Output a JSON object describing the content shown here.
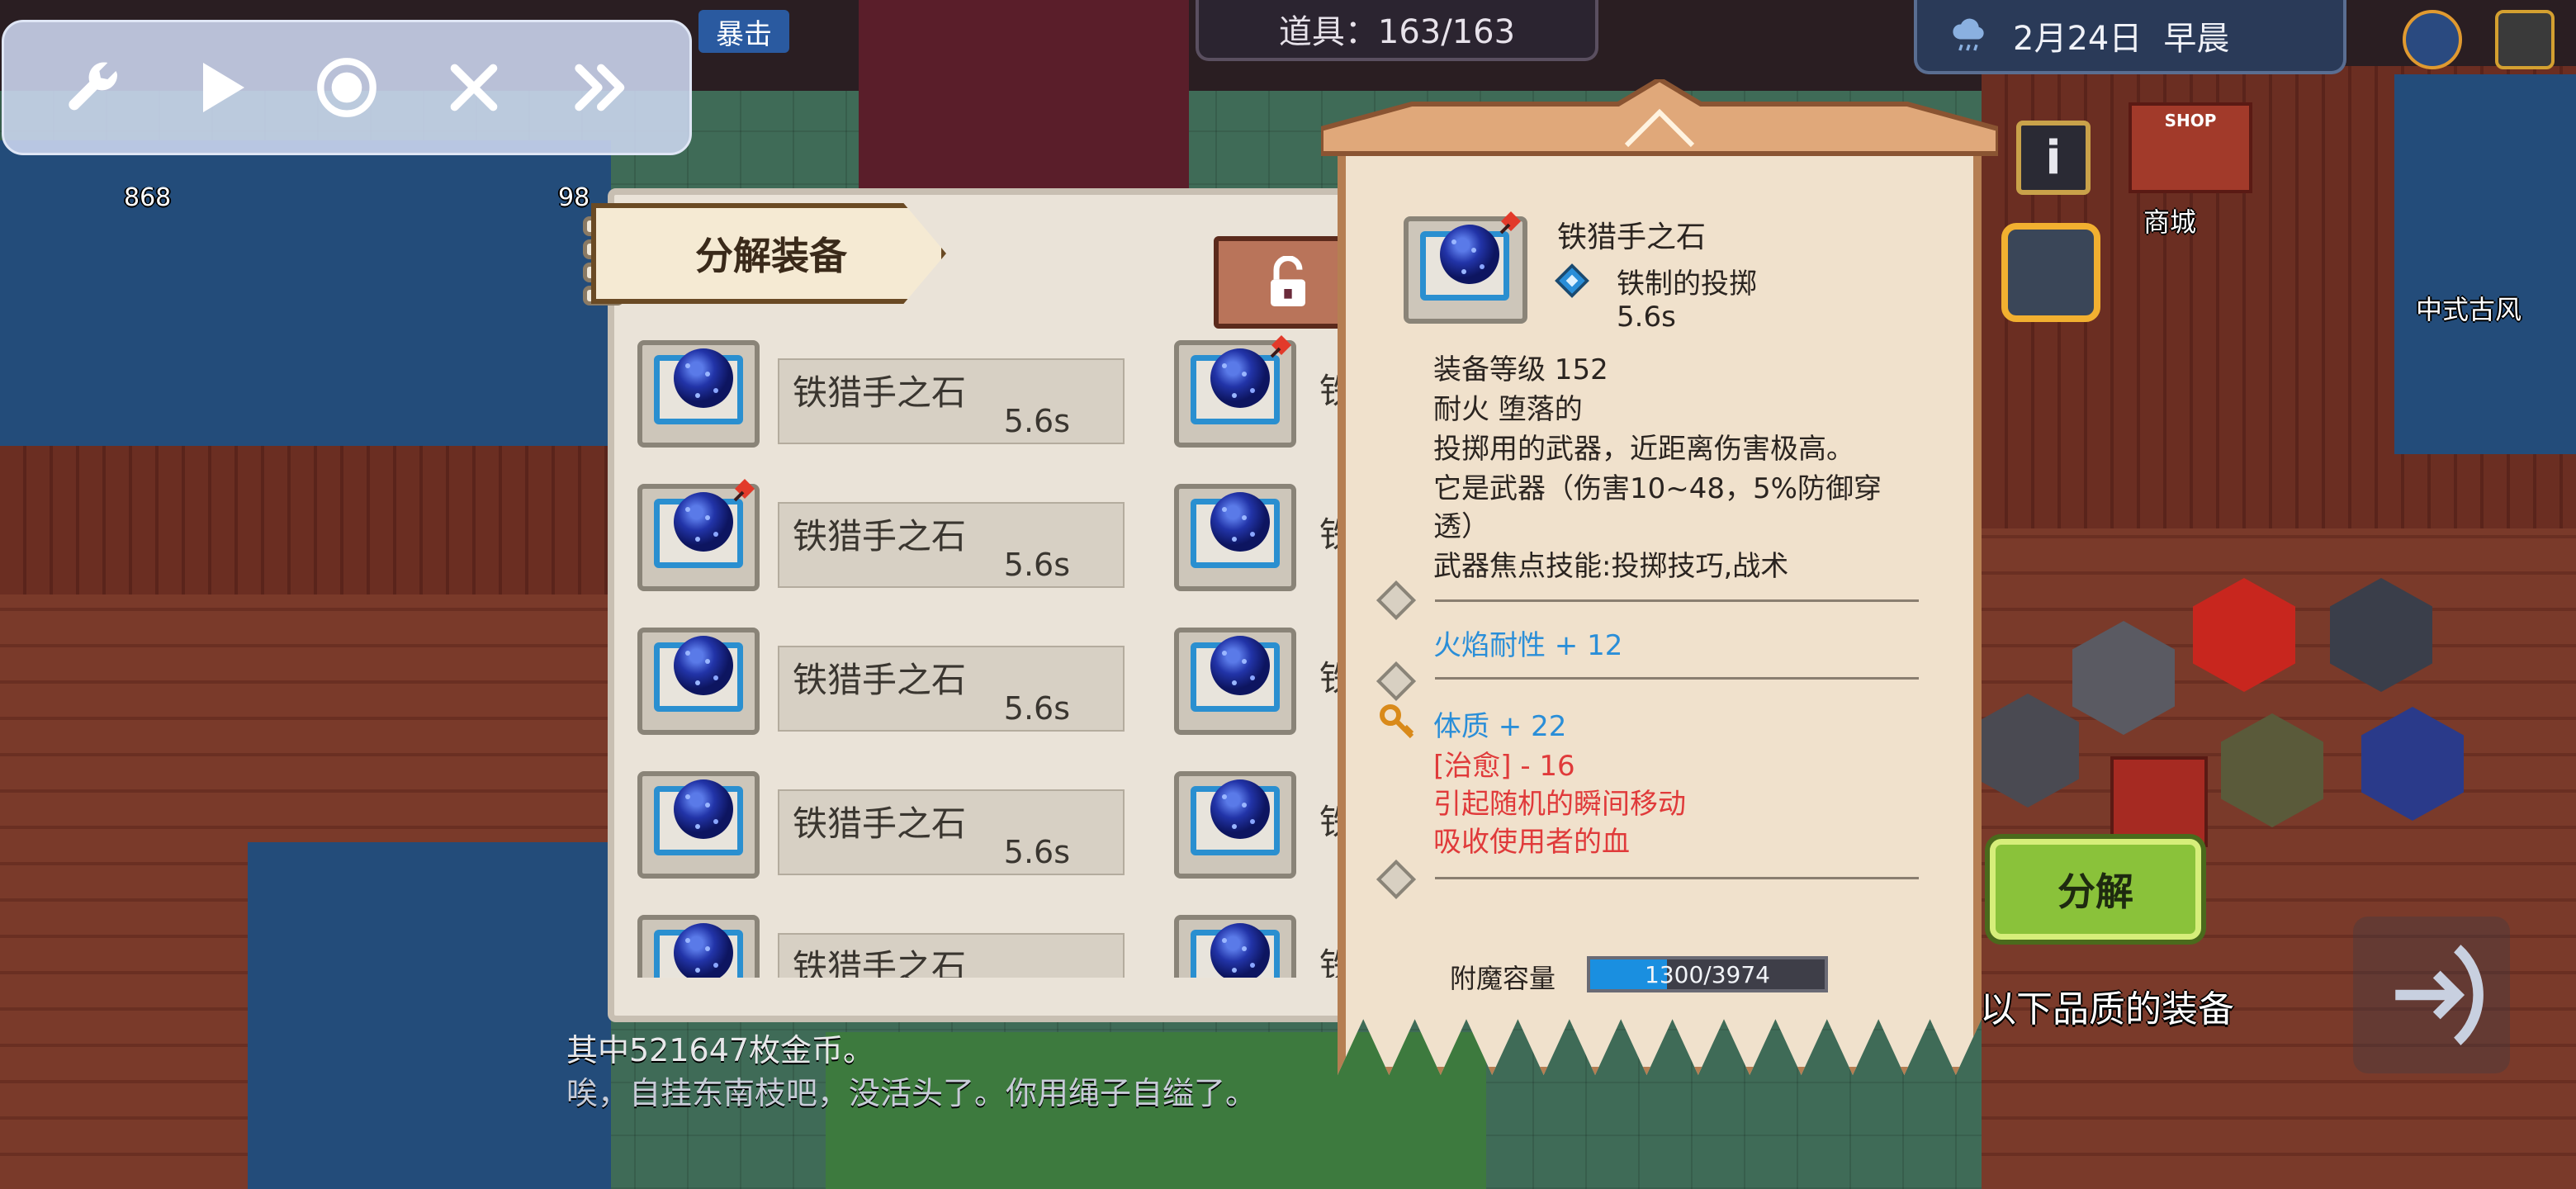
{
  "toolbar": {
    "buttons": [
      "settings",
      "play",
      "record",
      "close",
      "fast-forward"
    ]
  },
  "top_bar": {
    "items_count": "道具：163/163",
    "date": "2月24日",
    "time_of_day": "早晨",
    "attack_tag": "暴击",
    "counter_left": "868",
    "counter_mid": "98"
  },
  "panel": {
    "title": "分解装备",
    "items": [
      {
        "name": "铁猎手之石",
        "time": "5.6s"
      },
      {
        "name": "铁猎手之石",
        "time": "5.6s"
      },
      {
        "name": "铁猎手之石",
        "time": "5.6s"
      },
      {
        "name": "铁猎手之石",
        "time": "5.6s"
      },
      {
        "name": "铁猎手之石",
        "time": ""
      }
    ],
    "col2_label": "铁"
  },
  "tooltip": {
    "name": "铁猎手之石",
    "type": "铁制的投掷",
    "speed": "5.6s",
    "level": "装备等级 152",
    "traits": "耐火 堕落的",
    "desc1": "投掷用的武器，近距离伤害极高。",
    "desc2": "它是武器（伤害10~48，5%防御穿",
    "desc3": "透）",
    "skill": "武器焦点技能:投掷技巧,战术",
    "stat_fire": "火焰耐性 + 12",
    "stat_con": "体质 + 22",
    "stat_heal": "[治愈] - 16",
    "stat_teleport": "引起随机的瞬间移动",
    "stat_drain": "吸收使用者的血",
    "enchant_label": "附魔容量",
    "enchant_value": "1300/3974",
    "enchant_fraction": 0.327
  },
  "hud": {
    "decompose_label": "分解",
    "quality_text": "以下品质的装备",
    "shop_label": "商城",
    "shop_sign": "SHOP",
    "style_label": "中式古风",
    "info_label": "i"
  },
  "chat": {
    "line1": "其中521647枚金币。",
    "line2": "唉，自挂东南枝吧，没活头了。你用绳子自缢了。"
  },
  "colors": {
    "accent_green": "#8ac23a",
    "stat_blue": "#2a8ed8",
    "stat_red": "#e03a3a",
    "enchant_blue": "#1a8fe0"
  }
}
